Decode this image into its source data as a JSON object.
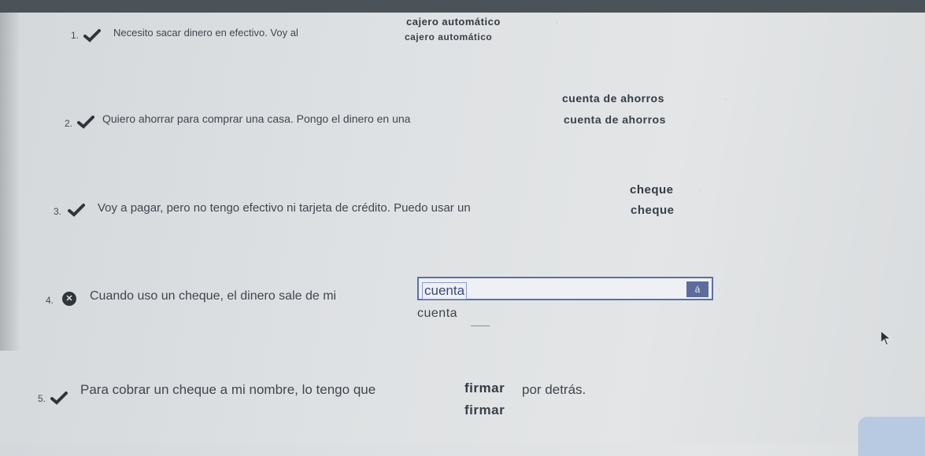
{
  "questions": [
    {
      "number": "1.",
      "status": "correct",
      "prompt": "Necesito sacar dinero en efectivo. Voy al",
      "answer": "cajero automático",
      "correct_answer": "cajero automático",
      "trailing": "."
    },
    {
      "number": "2.",
      "status": "correct",
      "prompt": "Quiero ahorrar para comprar una casa. Pongo el dinero en una",
      "answer": "cuenta de ahorros",
      "correct_answer": "cuenta de ahorros",
      "trailing": "."
    },
    {
      "number": "3.",
      "status": "correct",
      "prompt": "Voy a pagar, pero no tengo efectivo ni tarjeta de crédito. Puedo usar un",
      "answer": "cheque",
      "correct_answer": "cheque",
      "trailing": "."
    },
    {
      "number": "4.",
      "status": "incorrect",
      "prompt": "Cuando uso un cheque, el dinero sale de mi",
      "answer": "cuenta",
      "correct_answer": "cuenta",
      "input_button": "á",
      "trailing": "."
    },
    {
      "number": "5.",
      "status": "correct",
      "prompt": "Para cobrar un cheque a mi nombre, lo tengo que",
      "answer": "firmar",
      "correct_answer": "firmar",
      "trailing": "por detrás."
    }
  ],
  "colors": {
    "check": "#2f353b",
    "input_border": "#5c6fa6",
    "input_button": "#5d6c9c"
  }
}
